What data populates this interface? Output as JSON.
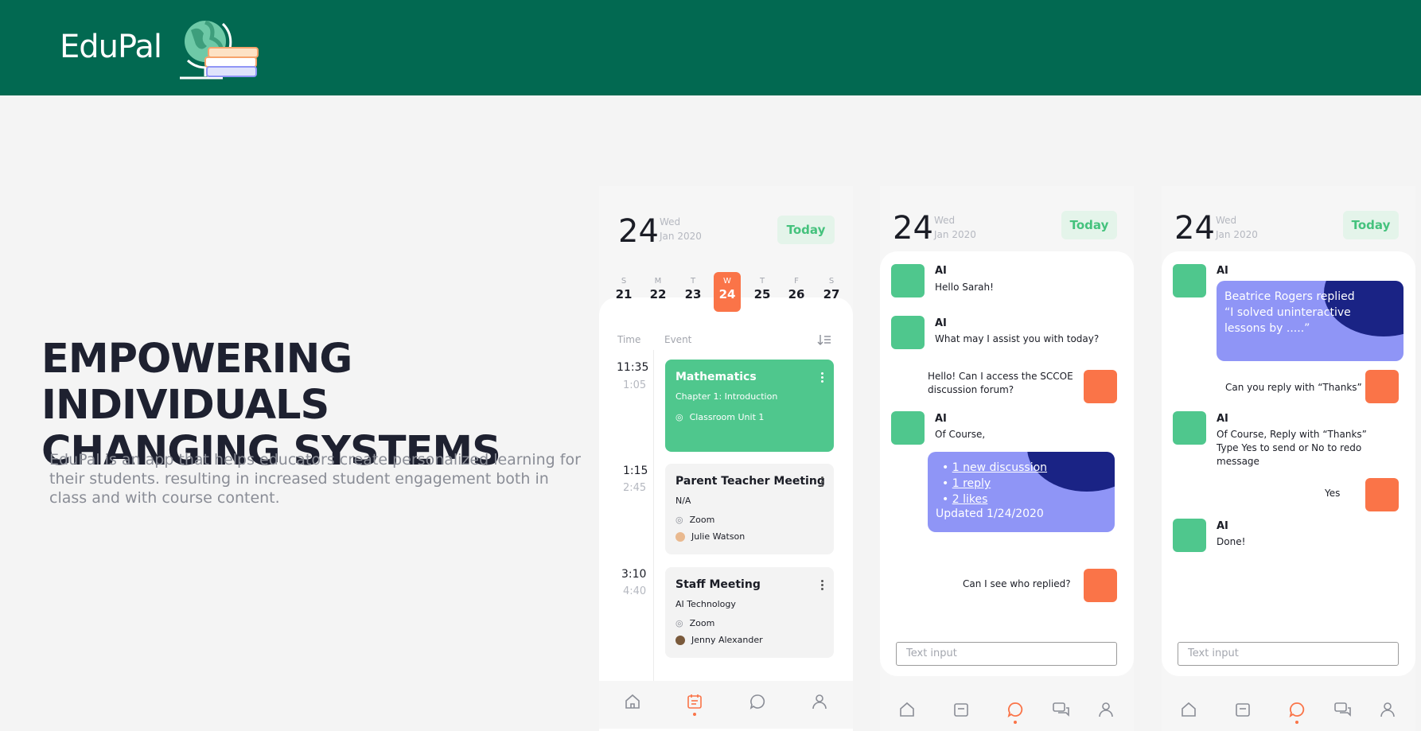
{
  "brand": {
    "name": "EduPal",
    "header_color": "#026951",
    "accent_green": "#4fc78d",
    "accent_orange": "#fa7448",
    "accent_purple": "#8f95f6"
  },
  "hero": {
    "title_line1": "EMPOWERING INDIVIDUALS",
    "title_line2": "CHANGING SYSTEMS",
    "subtitle": "EduPal is an app that helps educators create personalized learning for their students. resulting in increased student engagement both in class and with course content."
  },
  "phone1": {
    "date_num": "24",
    "weekday": "Wed",
    "month_year": "Jan 2020",
    "today_label": "Today",
    "week": [
      {
        "l": "S",
        "n": "21"
      },
      {
        "l": "M",
        "n": "22"
      },
      {
        "l": "T",
        "n": "23"
      },
      {
        "l": "W",
        "n": "24"
      },
      {
        "l": "T",
        "n": "25"
      },
      {
        "l": "F",
        "n": "26"
      },
      {
        "l": "S",
        "n": "27"
      }
    ],
    "col_time": "Time",
    "col_event": "Event",
    "events": [
      {
        "start": "11:35",
        "end": "1:05",
        "title": "Mathematics",
        "sub": "Chapter 1: Introduction",
        "loc": "Classroom Unit 1"
      },
      {
        "start": "1:15",
        "end": "2:45",
        "title": "Parent Teacher Meeting",
        "sub": "N/A",
        "loc": "Zoom",
        "person": "Julie Watson"
      },
      {
        "start": "3:10",
        "end": "4:40",
        "title": "Staff Meeting",
        "sub": "AI Technology",
        "loc": "Zoom",
        "person": "Jenny Alexander"
      }
    ]
  },
  "phone2": {
    "date_num": "24",
    "weekday": "Wed",
    "month_year": "Jan 2020",
    "today_label": "Today",
    "m1_name": "AI",
    "m1_text": "Hello Sarah!",
    "m2_name": "AI",
    "m2_text": "What may I assist you with today?",
    "m3_line1": "Hello! Can I access the SCCOE",
    "m3_line2": "discussion forum?",
    "m4_name": "AI",
    "m4_text": "Of Course,",
    "bullet1": "1 new discussion",
    "bullet2": "1 reply",
    "bullet3": "2 likes",
    "updated": "Updated 1/24/2020",
    "m5_text": "Can I see who replied?",
    "input_placeholder": "Text input"
  },
  "phone3": {
    "date_num": "24",
    "weekday": "Wed",
    "month_year": "Jan 2020",
    "today_label": "Today",
    "m1_name": "AI",
    "reply_line1": "Beatrice Rogers replied",
    "reply_line2": "“I solved uninteractive",
    "reply_line3": "lessons by .....”",
    "m2_text": "Can you reply with “Thanks”",
    "m3_name": "AI",
    "m3_line1": "Of Course, Reply with “Thanks”",
    "m3_line2": "Type Yes to send or No to redo",
    "m3_line3": "message",
    "m4_text": "Yes",
    "m5_name": "AI",
    "m5_text": "Done!",
    "input_placeholder": "Text input"
  }
}
